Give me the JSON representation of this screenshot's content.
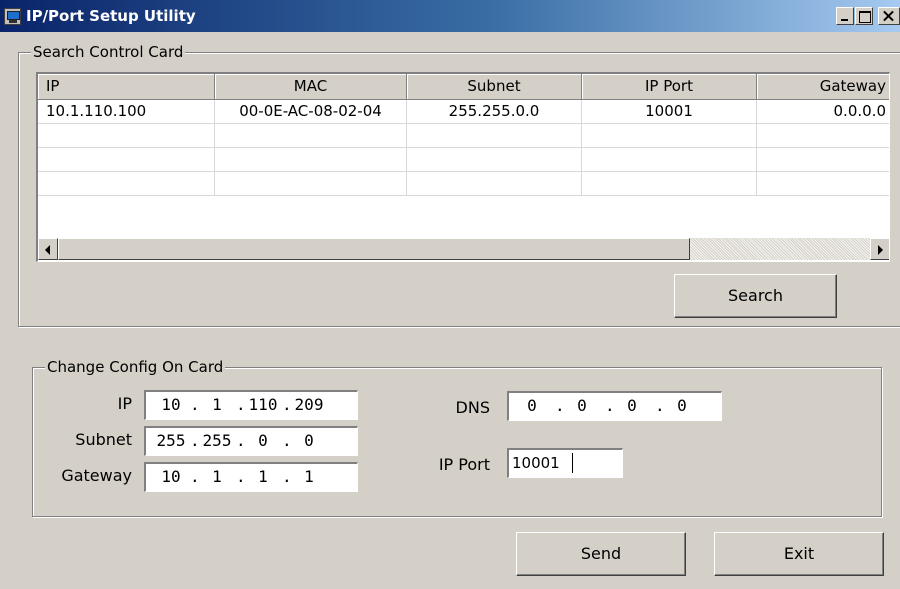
{
  "window": {
    "title": "IP/Port Setup Utility"
  },
  "search_group": {
    "legend": "Search Control Card",
    "columns": [
      "IP",
      "MAC",
      "Subnet",
      "IP Port",
      "Gateway"
    ],
    "rows": [
      {
        "ip": "10.1.110.100",
        "mac": "00-0E-AC-08-02-04",
        "subnet": "255.255.0.0",
        "port": "10001",
        "gateway": "0.0.0.0"
      }
    ],
    "search_label": "Search"
  },
  "change_group": {
    "legend": "Change Config On Card",
    "ip_label": "IP",
    "subnet_label": "Subnet",
    "gateway_label": "Gateway",
    "dns_label": "DNS",
    "port_label": "IP Port",
    "ip": [
      "10",
      "1",
      "110",
      "209"
    ],
    "subnet": [
      "255",
      "255",
      "0",
      "0"
    ],
    "gateway": [
      "10",
      "1",
      "1",
      "1"
    ],
    "dns": [
      "0",
      "0",
      "0",
      "0"
    ],
    "ip_port": "10001"
  },
  "actions": {
    "send_label": "Send",
    "exit_label": "Exit"
  }
}
